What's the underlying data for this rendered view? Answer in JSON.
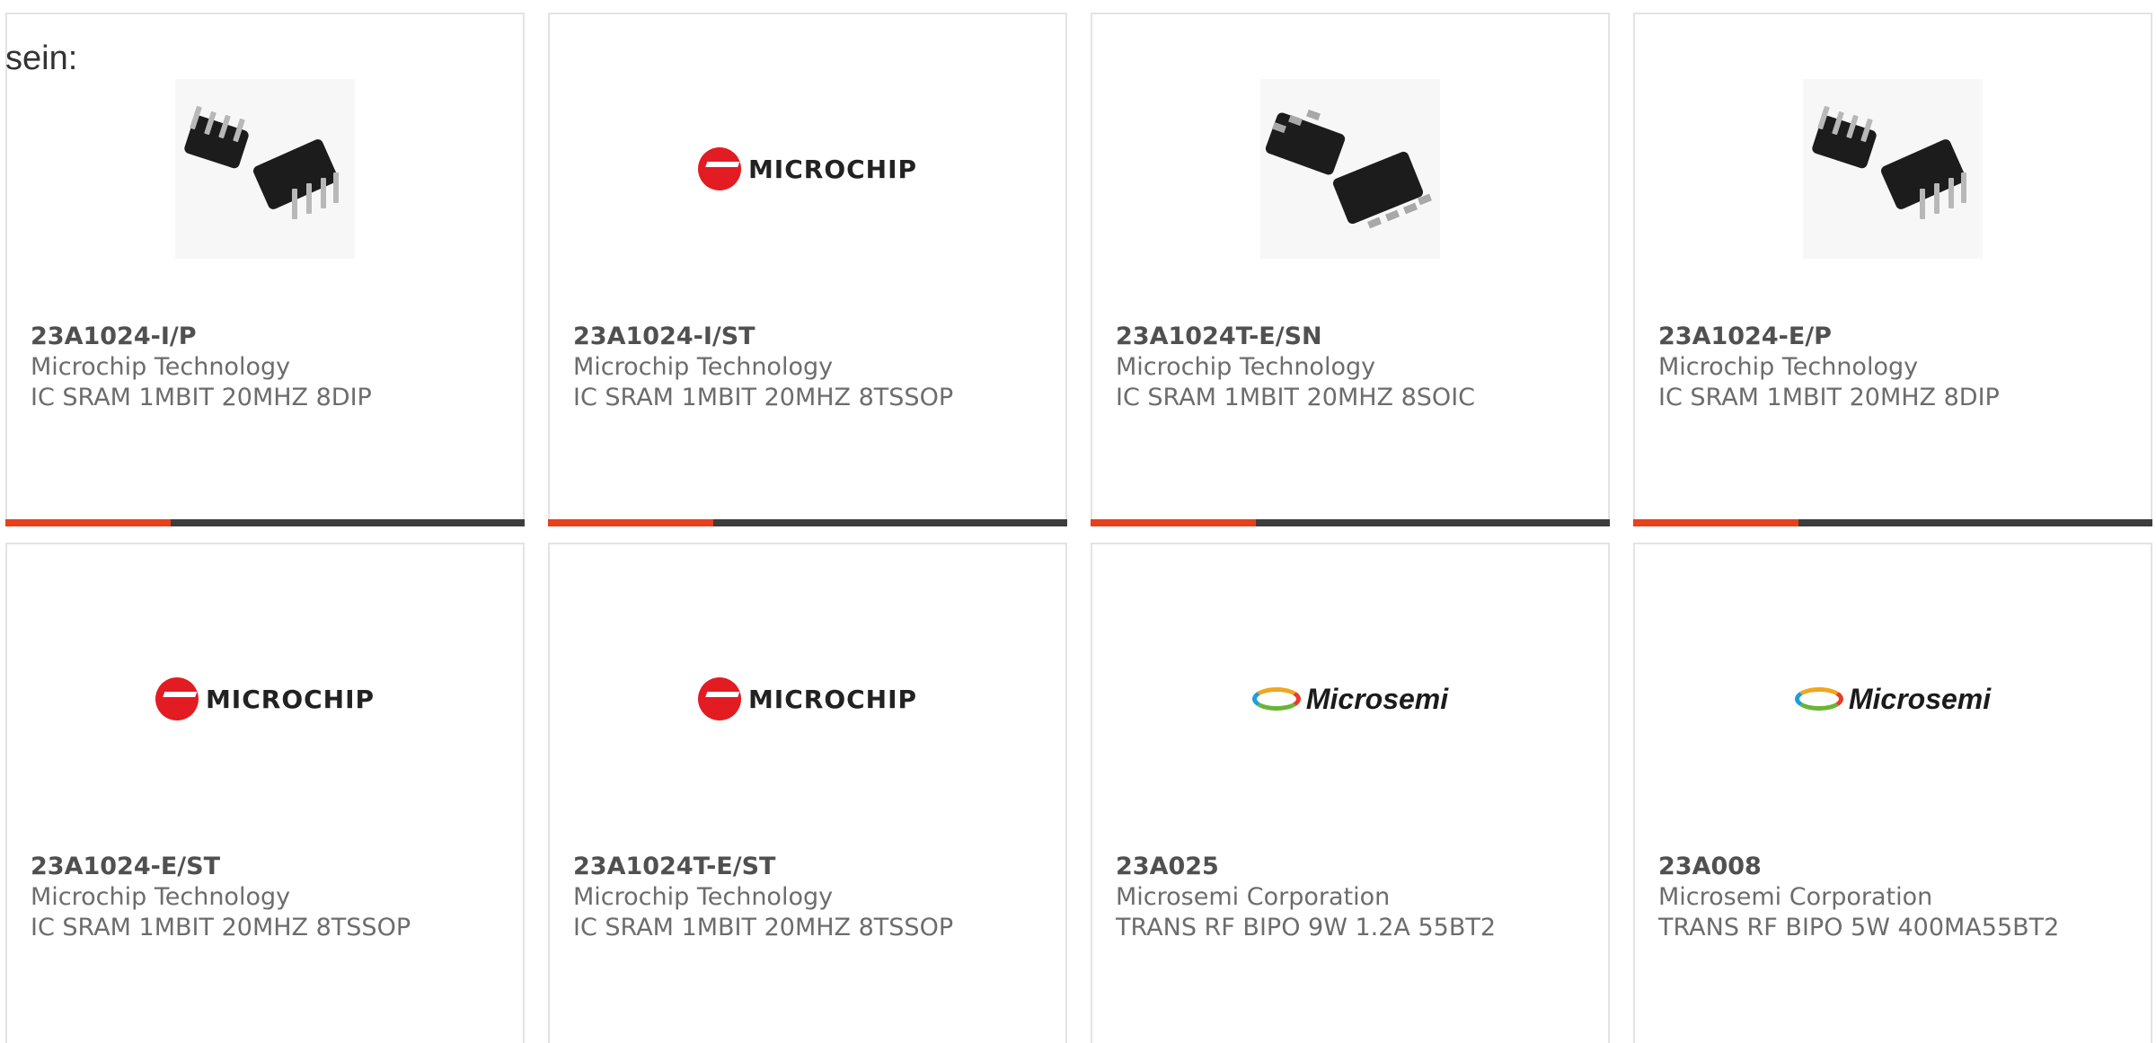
{
  "intro_text": "sein:",
  "products": [
    {
      "part_number": "23A1024-I/P",
      "manufacturer": "Microchip Technology",
      "description": "IC SRAM 1MBIT 20MHZ 8DIP",
      "image": "dip-chip-photo"
    },
    {
      "part_number": "23A1024-I/ST",
      "manufacturer": "Microchip Technology",
      "description": "IC SRAM 1MBIT 20MHZ 8TSSOP",
      "image": "microchip-logo",
      "logo_text": "MICROCHIP"
    },
    {
      "part_number": "23A1024T-E/SN",
      "manufacturer": "Microchip Technology",
      "description": "IC SRAM 1MBIT 20MHZ 8SOIC",
      "image": "soic-chip-photo"
    },
    {
      "part_number": "23A1024-E/P",
      "manufacturer": "Microchip Technology",
      "description": "IC SRAM 1MBIT 20MHZ 8DIP",
      "image": "dip-chip-photo"
    },
    {
      "part_number": "23A1024-E/ST",
      "manufacturer": "Microchip Technology",
      "description": "IC SRAM 1MBIT 20MHZ 8TSSOP",
      "image": "microchip-logo",
      "logo_text": "MICROCHIP"
    },
    {
      "part_number": "23A1024T-E/ST",
      "manufacturer": "Microchip Technology",
      "description": "IC SRAM 1MBIT 20MHZ 8TSSOP",
      "image": "microchip-logo",
      "logo_text": "MICROCHIP"
    },
    {
      "part_number": "23A025",
      "manufacturer": "Microsemi Corporation",
      "description": "TRANS RF BIPO 9W 1.2A 55BT2",
      "image": "microsemi-logo",
      "logo_text": "Microsemi"
    },
    {
      "part_number": "23A008",
      "manufacturer": "Microsemi Corporation",
      "description": "TRANS RF BIPO 5W 400MA55BT2",
      "image": "microsemi-logo",
      "logo_text": "Microsemi"
    }
  ],
  "colors": {
    "accent_bar": "#e7401c",
    "dark_bar": "#3d3d3d",
    "card_border": "#e3e3e3",
    "part_number_text": "#505050",
    "secondary_text": "#6c6c6c"
  }
}
